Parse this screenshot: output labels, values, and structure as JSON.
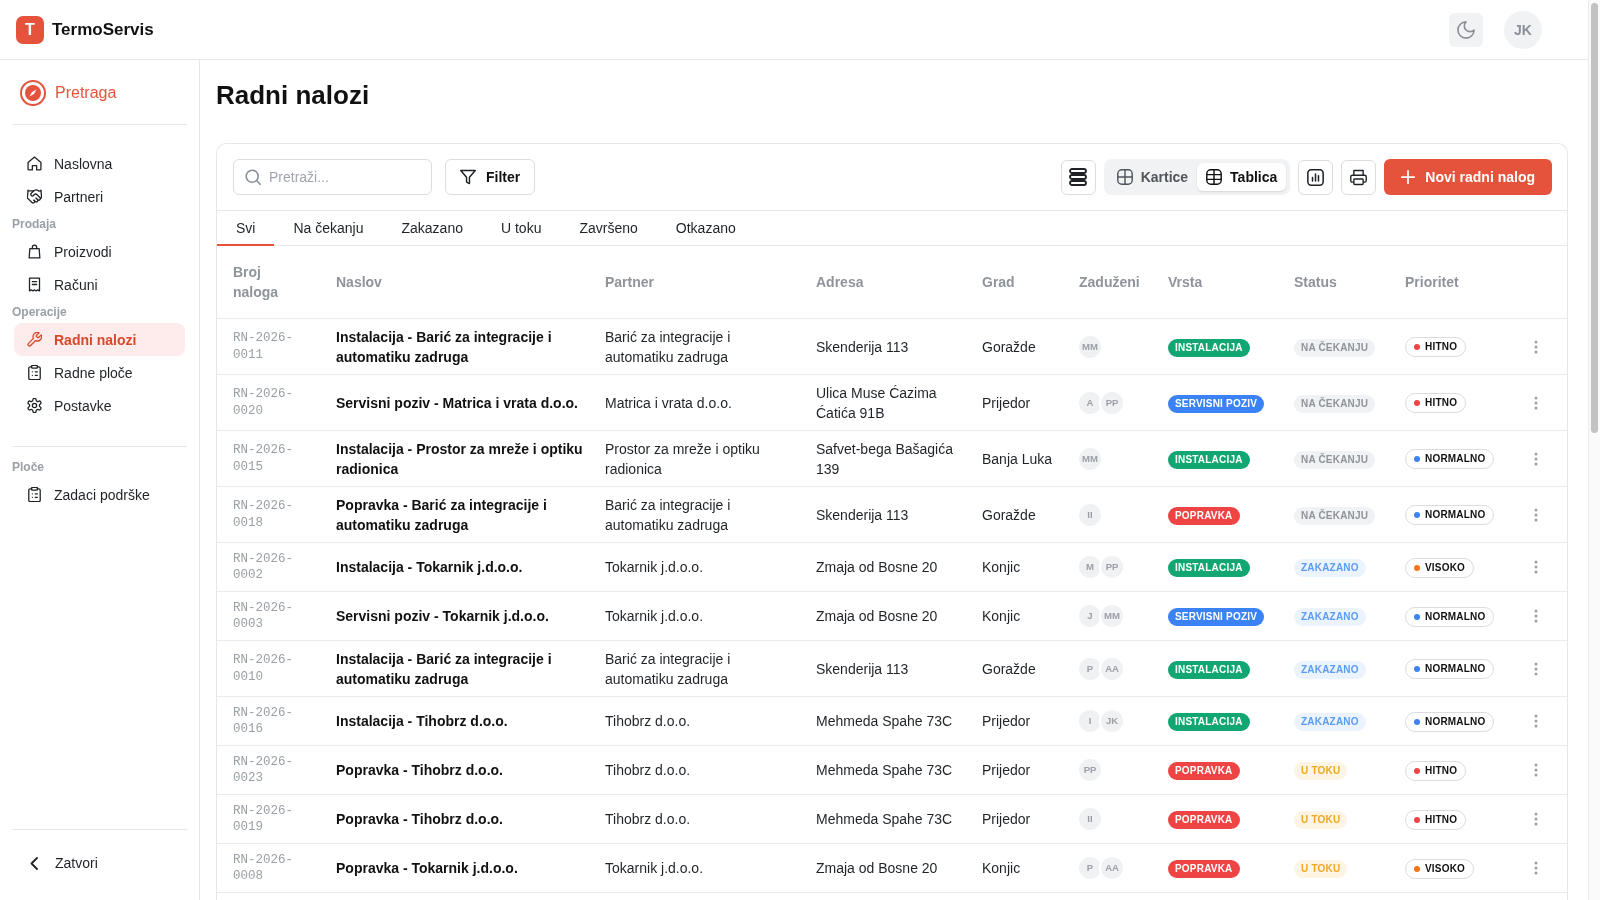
{
  "app": {
    "logo_letter": "T",
    "name": "TermoServis"
  },
  "header": {
    "avatar_initials": "JK"
  },
  "sidebar": {
    "search_item": {
      "label": "Pretraga"
    },
    "menu": [
      {
        "items": [
          {
            "label": "Naslovna",
            "selected": false
          },
          {
            "label": "Partneri",
            "selected": false
          }
        ]
      },
      {
        "heading": "Prodaja",
        "items": [
          {
            "label": "Proizvodi",
            "selected": false
          },
          {
            "label": "Računi",
            "selected": false
          }
        ]
      },
      {
        "heading": "Operacije",
        "items": [
          {
            "label": "Radni nalozi",
            "selected": true
          },
          {
            "label": "Radne ploče",
            "selected": false
          },
          {
            "label": "Postavke",
            "selected": false
          }
        ]
      }
    ],
    "boards": {
      "heading": "Ploče",
      "items": [
        {
          "label": "Zadaci podrške",
          "selected": false
        }
      ]
    },
    "close": {
      "label": "Zatvori"
    }
  },
  "page": {
    "title": "Radni nalozi"
  },
  "toolbar": {
    "search": {
      "placeholder": "Pretraži..."
    },
    "filter": {
      "label": "Filter"
    },
    "views": [
      {
        "label": "Kartice",
        "selected": false
      },
      {
        "label": "Tablica",
        "selected": true
      }
    ],
    "new_button": {
      "label": "Novi radni nalog"
    }
  },
  "tabs": [
    {
      "label": "Svi",
      "selected": true
    },
    {
      "label": "Na čekanju",
      "selected": false
    },
    {
      "label": "Zakazano",
      "selected": false
    },
    {
      "label": "U toku",
      "selected": false
    },
    {
      "label": "Završeno",
      "selected": false
    },
    {
      "label": "Otkazano",
      "selected": false
    }
  ],
  "table": {
    "columns": [
      "Broj naloga",
      "Naslov",
      "Partner",
      "Adresa",
      "Grad",
      "Zaduženi",
      "Vrsta",
      "Status",
      "Prioritet"
    ],
    "rows": [
      {
        "number": "RN-2026-0011",
        "title": "Instalacija - Barić za integracije i automatiku zadruga",
        "partner": "Barić za integracije i automatiku zadruga",
        "address": "Skenderija 113",
        "city": "Goražde",
        "assignees": [
          "MM"
        ],
        "type": {
          "label": "INSTALACIJA",
          "color": "#12a672"
        },
        "status": {
          "label": "NA ČEKANJU",
          "color": "#8f949c"
        },
        "priority": {
          "label": "HITNO",
          "color": "#ef4444"
        }
      },
      {
        "number": "RN-2026-0020",
        "title": "Servisni poziv - Matrica i vrata d.o.o.",
        "partner": "Matrica i vrata d.o.o.",
        "address": "Ulica Muse Ćazima Ćatića 91B",
        "city": "Prijedor",
        "assignees": [
          "A",
          "PP"
        ],
        "type": {
          "label": "SERVISNI POZIV",
          "color": "#3b82f6"
        },
        "status": {
          "label": "NA ČEKANJU",
          "color": "#8f949c"
        },
        "priority": {
          "label": "HITNO",
          "color": "#ef4444"
        }
      },
      {
        "number": "RN-2026-0015",
        "title": "Instalacija - Prostor za mreže i optiku radionica",
        "partner": "Prostor za mreže i optiku radionica",
        "address": "Safvet-bega Bašagića 139",
        "city": "Banja Luka",
        "assignees": [
          "MM"
        ],
        "type": {
          "label": "INSTALACIJA",
          "color": "#12a672"
        },
        "status": {
          "label": "NA ČEKANJU",
          "color": "#8f949c"
        },
        "priority": {
          "label": "NORMALNO",
          "color": "#3b82f6"
        }
      },
      {
        "number": "RN-2026-0018",
        "title": "Popravka - Barić za integracije i automatiku zadruga",
        "partner": "Barić za integracije i automatiku zadruga",
        "address": "Skenderija 113",
        "city": "Goražde",
        "assignees": [
          "II"
        ],
        "type": {
          "label": "POPRAVKA",
          "color": "#ef4444"
        },
        "status": {
          "label": "NA ČEKANJU",
          "color": "#8f949c"
        },
        "priority": {
          "label": "NORMALNO",
          "color": "#3b82f6"
        }
      },
      {
        "number": "RN-2026-0002",
        "title": "Instalacija - Tokarnik j.d.o.o.",
        "partner": "Tokarnik j.d.o.o.",
        "address": "Zmaja od Bosne 20",
        "city": "Konjic",
        "assignees": [
          "M",
          "PP"
        ],
        "type": {
          "label": "INSTALACIJA",
          "color": "#12a672"
        },
        "status": {
          "label": "ZAKAZANO",
          "color": "#5b9cf5"
        },
        "priority": {
          "label": "VISOKO",
          "color": "#f97316"
        }
      },
      {
        "number": "RN-2026-0003",
        "title": "Servisni poziv - Tokarnik j.d.o.o.",
        "partner": "Tokarnik j.d.o.o.",
        "address": "Zmaja od Bosne 20",
        "city": "Konjic",
        "assignees": [
          "J",
          "MM"
        ],
        "type": {
          "label": "SERVISNI POZIV",
          "color": "#3b82f6"
        },
        "status": {
          "label": "ZAKAZANO",
          "color": "#5b9cf5"
        },
        "priority": {
          "label": "NORMALNO",
          "color": "#3b82f6"
        }
      },
      {
        "number": "RN-2026-0010",
        "title": "Instalacija - Barić za integracije i automatiku zadruga",
        "partner": "Barić za integracije i automatiku zadruga",
        "address": "Skenderija 113",
        "city": "Goražde",
        "assignees": [
          "P",
          "AA"
        ],
        "type": {
          "label": "INSTALACIJA",
          "color": "#12a672"
        },
        "status": {
          "label": "ZAKAZANO",
          "color": "#5b9cf5"
        },
        "priority": {
          "label": "NORMALNO",
          "color": "#3b82f6"
        }
      },
      {
        "number": "RN-2026-0016",
        "title": "Instalacija - Tihobrz d.o.o.",
        "partner": "Tihobrz d.o.o.",
        "address": "Mehmeda Spahe 73C",
        "city": "Prijedor",
        "assignees": [
          "I",
          "JK"
        ],
        "type": {
          "label": "INSTALACIJA",
          "color": "#12a672"
        },
        "status": {
          "label": "ZAKAZANO",
          "color": "#5b9cf5"
        },
        "priority": {
          "label": "NORMALNO",
          "color": "#3b82f6"
        }
      },
      {
        "number": "RN-2026-0023",
        "title": "Popravka - Tihobrz d.o.o.",
        "partner": "Tihobrz d.o.o.",
        "address": "Mehmeda Spahe 73C",
        "city": "Prijedor",
        "assignees": [
          "PP"
        ],
        "type": {
          "label": "POPRAVKA",
          "color": "#ef4444"
        },
        "status": {
          "label": "U TOKU",
          "color": "#f0a820"
        },
        "priority": {
          "label": "HITNO",
          "color": "#ef4444"
        }
      },
      {
        "number": "RN-2026-0019",
        "title": "Popravka - Tihobrz d.o.o.",
        "partner": "Tihobrz d.o.o.",
        "address": "Mehmeda Spahe 73C",
        "city": "Prijedor",
        "assignees": [
          "II"
        ],
        "type": {
          "label": "POPRAVKA",
          "color": "#ef4444"
        },
        "status": {
          "label": "U TOKU",
          "color": "#f0a820"
        },
        "priority": {
          "label": "HITNO",
          "color": "#ef4444"
        }
      },
      {
        "number": "RN-2026-0008",
        "title": "Popravka - Tokarnik j.d.o.o.",
        "partner": "Tokarnik j.d.o.o.",
        "address": "Zmaja od Bosne 20",
        "city": "Konjic",
        "assignees": [
          "P",
          "AA"
        ],
        "type": {
          "label": "POPRAVKA",
          "color": "#ef4444"
        },
        "status": {
          "label": "U TOKU",
          "color": "#f0a820"
        },
        "priority": {
          "label": "VISOKO",
          "color": "#f97316"
        }
      }
    ]
  }
}
